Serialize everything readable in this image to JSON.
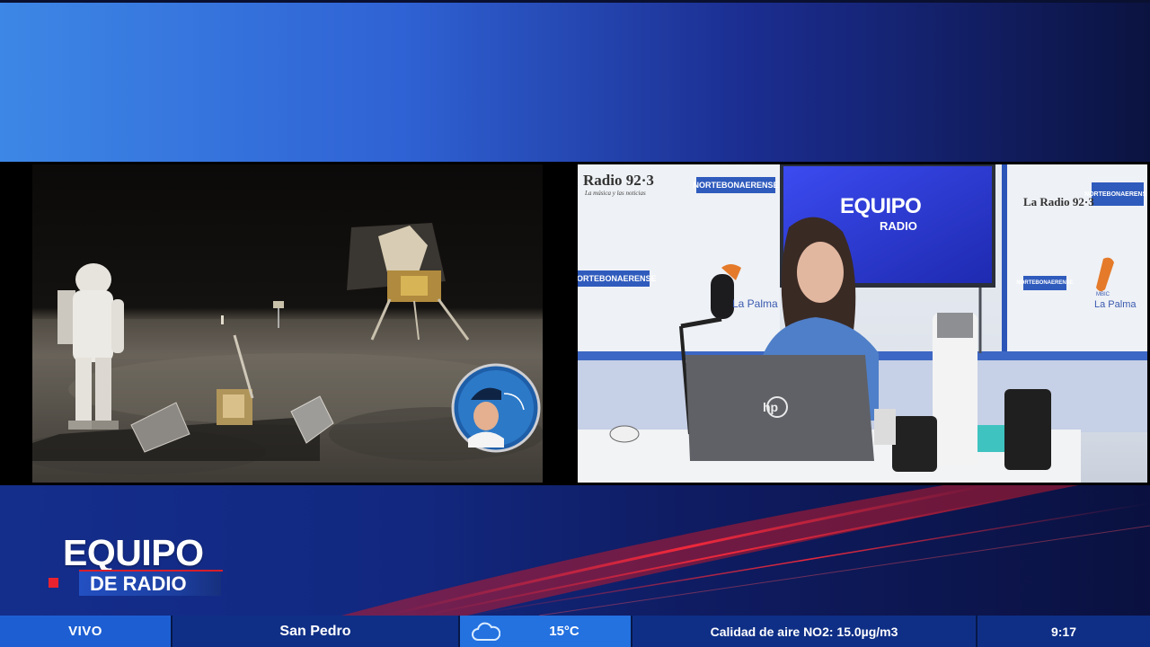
{
  "broadcast": {
    "studio_logo_title": "EQUIPO",
    "studio_logo_sub": "RADIO",
    "studio_signs": {
      "radio_923_left": "Radio 92·3",
      "radio_923_left_tag": "La música y las noticias",
      "norte_bonaerense": "NORTEBONAERENSE",
      "radio_923_right": "La Radio 92·3",
      "la_palma": "La Palma",
      "la_palma_small": "MBIC"
    },
    "laptop_brand": "hp"
  },
  "lower_third": {
    "logo_title": "EQUIPO",
    "logo_subtitle": "DE RADIO"
  },
  "ticker": {
    "status": "VIVO",
    "city": "San Pedro",
    "weather_icon": "cloud-icon",
    "temperature": "15°C",
    "air_quality": "Calidad de aire NO2:  15.0µg/m3",
    "time": "9:17"
  },
  "colors": {
    "accent_red": "#e8232f",
    "ticker_blue": "#1d5fd3",
    "weather_blue": "#2471e0"
  }
}
